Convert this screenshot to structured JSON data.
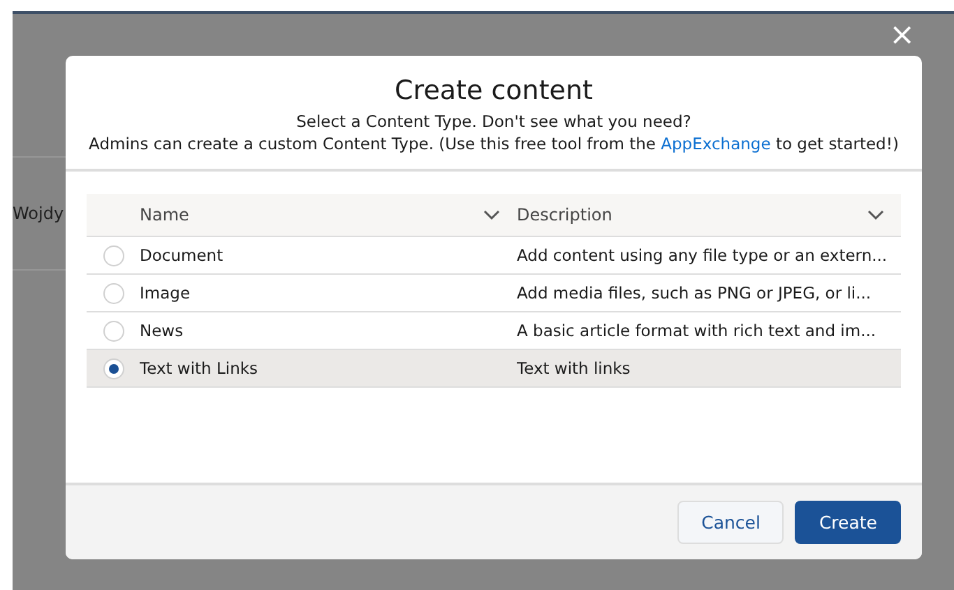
{
  "background": {
    "text": "Wojdy"
  },
  "close_button": {
    "label": "×"
  },
  "modal": {
    "title": "Create content",
    "subtitle": "Select a Content Type. Don't see what you need?",
    "help_before": "Admins can create a custom Content Type. (Use this free tool from the",
    "help_link": "AppExchange",
    "help_after": "to get started!)",
    "table": {
      "columns": [
        {
          "label": "Name"
        },
        {
          "label": "Description"
        }
      ],
      "rows": [
        {
          "name": "Document",
          "description": "Add content using any file type or an extern...",
          "selected": false
        },
        {
          "name": "Image",
          "description": "Add media files, such as PNG or JPEG, or li...",
          "selected": false
        },
        {
          "name": "News",
          "description": "A basic article format with rich text and im...",
          "selected": false
        },
        {
          "name": "Text with Links",
          "description": "Text with links",
          "selected": true
        }
      ]
    },
    "buttons": [
      {
        "label": "Cancel",
        "kind": "neutral"
      },
      {
        "label": "Create",
        "kind": "brand"
      }
    ]
  }
}
